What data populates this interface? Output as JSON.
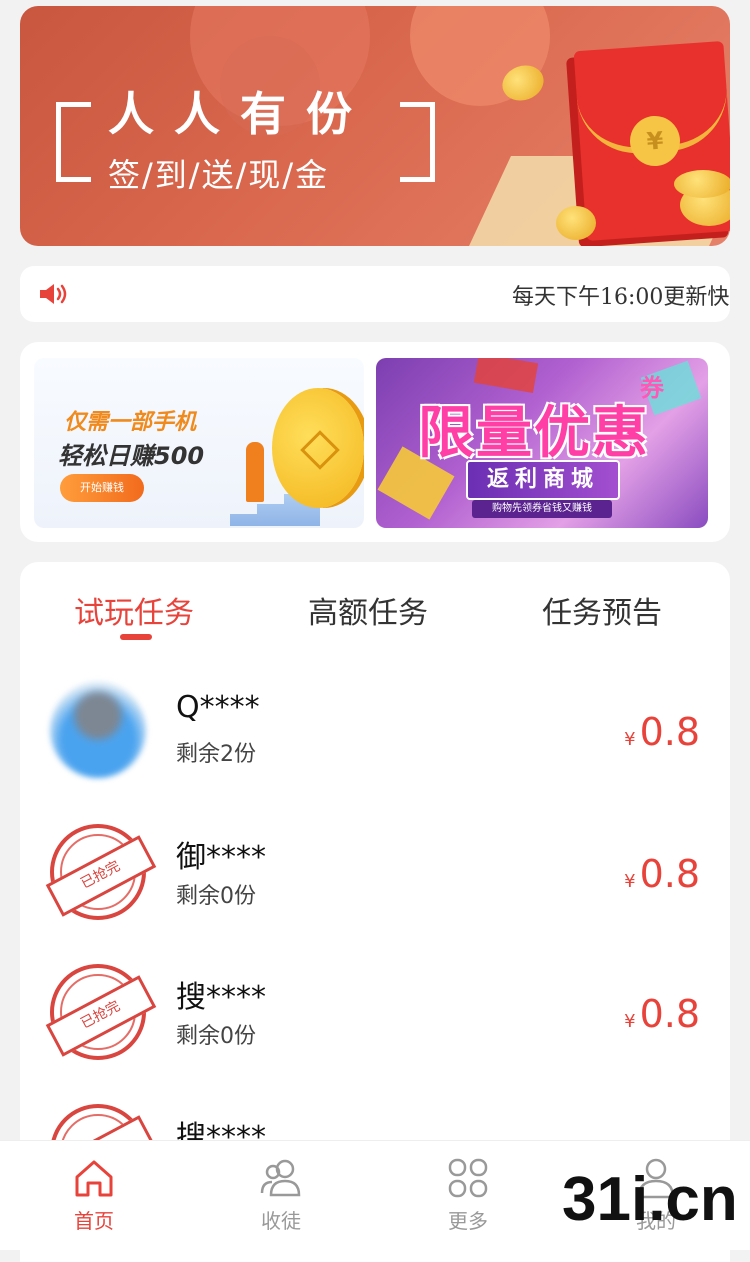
{
  "banner": {
    "title": "人人有份",
    "subtitle": "签/到/送/现/金"
  },
  "notice": {
    "text": "每天下午16:00更新快"
  },
  "promo": {
    "left_line1": "仅需一部手机",
    "left_line2": "轻松日赚500",
    "left_button": "开始赚钱",
    "right_title": "限量优惠",
    "right_badge": "券",
    "right_subtitle": "返利商城",
    "right_caption": "购物先领券省钱又赚钱"
  },
  "tabs": [
    {
      "label": "试玩任务",
      "active": true
    },
    {
      "label": "高额任务",
      "active": false
    },
    {
      "label": "任务预告",
      "active": false
    }
  ],
  "tasks": [
    {
      "name": "Q****",
      "remaining": "剩余2份",
      "currency": "¥",
      "price": "0.8",
      "status": "available"
    },
    {
      "name": "御****",
      "remaining": "剩余0份",
      "currency": "¥",
      "price": "0.8",
      "status": "sold_out"
    },
    {
      "name": "搜****",
      "remaining": "剩余0份",
      "currency": "¥",
      "price": "0.8",
      "status": "sold_out"
    },
    {
      "name": "搜****",
      "remaining": "",
      "currency": "",
      "price": "",
      "status": "sold_out"
    }
  ],
  "stamp_text": "已抢完",
  "nav": [
    {
      "label": "首页",
      "icon": "home-icon",
      "active": true
    },
    {
      "label": "收徒",
      "icon": "users-icon",
      "active": false
    },
    {
      "label": "更多",
      "icon": "grid-icon",
      "active": false
    },
    {
      "label": "我的",
      "icon": "user-icon",
      "active": false
    }
  ],
  "watermark": "31i.cn",
  "colors": {
    "accent": "#e8433b",
    "banner": "#d9684e",
    "nav_inactive": "#999999"
  }
}
